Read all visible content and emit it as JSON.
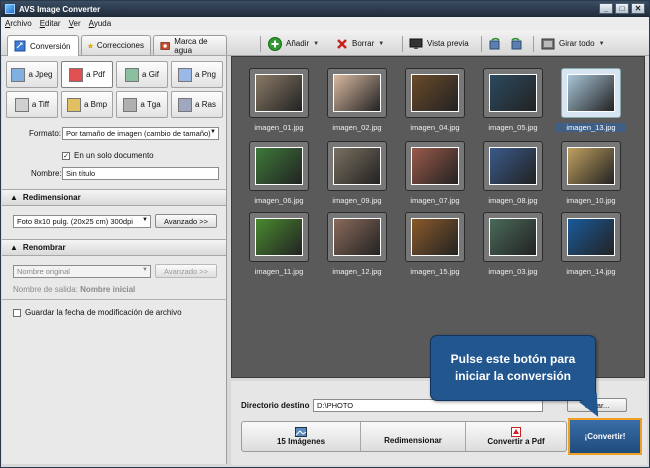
{
  "window": {
    "title": "AVS Image Converter"
  },
  "menu": [
    "Archivo",
    "Editar",
    "Ver",
    "Ayuda"
  ],
  "tabs": [
    {
      "label": "Conversión",
      "icon": "convert-icon",
      "active": true
    },
    {
      "label": "Correcciones",
      "icon": "star-icon",
      "active": false
    },
    {
      "label": "Marca de agua",
      "icon": "watermark-icon",
      "active": false
    }
  ],
  "toolbar": {
    "add": "Añadir",
    "delete": "Borrar",
    "preview": "Vista previa",
    "rotate_all": "Girar todo"
  },
  "formats": [
    "a Jpeg",
    "a Pdf",
    "a Gif",
    "a Png",
    "a Tiff",
    "a Bmp",
    "a Tga",
    "a Ras"
  ],
  "active_format": "a Pdf",
  "format_label": "Formato:",
  "format_value": "Por tamaño de imagen (cambio de tamaño)",
  "single_doc_label": "En un solo documento",
  "single_doc_checked": true,
  "name_label": "Nombre:",
  "name_value": "Sin título",
  "resize": {
    "header": "Redimensionar",
    "preset": "Foto 8x10 pulg. (20x25 cm) 300dpi",
    "advanced": "Avanzado >>"
  },
  "rename": {
    "header": "Renombrar",
    "preset": "Nombre original",
    "advanced": "Avanzado >>",
    "output_label": "Nombre de salida:",
    "output_value": "Nombre inicial"
  },
  "keep_date_label": "Guardar la fecha de modificación de archivo",
  "images": [
    {
      "name": "imagen_01.jpg",
      "color": "#8a7a66",
      "selected": false
    },
    {
      "name": "imagen_02.jpg",
      "color": "#d9b9a0",
      "selected": false
    },
    {
      "name": "imagen_04.jpg",
      "color": "#6b4b2a",
      "selected": false
    },
    {
      "name": "imagen_05.jpg",
      "color": "#2c4a60",
      "selected": false
    },
    {
      "name": "imagen_13.jpg",
      "color": "#a9c6d8",
      "selected": true
    },
    {
      "name": "imagen_06.jpg",
      "color": "#3d7a3a",
      "selected": false
    },
    {
      "name": "imagen_09.jpg",
      "color": "#7a7060",
      "selected": false
    },
    {
      "name": "imagen_07.jpg",
      "color": "#9a5a4a",
      "selected": false
    },
    {
      "name": "imagen_08.jpg",
      "color": "#3a5a8a",
      "selected": false
    },
    {
      "name": "imagen_10.jpg",
      "color": "#c0a060",
      "selected": false
    },
    {
      "name": "imagen_11.jpg",
      "color": "#4a8a30",
      "selected": false
    },
    {
      "name": "imagen_12.jpg",
      "color": "#8a6a5a",
      "selected": false
    },
    {
      "name": "imagen_15.jpg",
      "color": "#8a5a2a",
      "selected": false
    },
    {
      "name": "imagen_03.jpg",
      "color": "#4a6a5a",
      "selected": false
    },
    {
      "name": "imagen_14.jpg",
      "color": "#1a5a9a",
      "selected": false
    }
  ],
  "destination": {
    "label": "Directorio destino",
    "value": "D:\\PHOTO",
    "browse": "...inar..."
  },
  "steps": {
    "images_count": "15 Imágenes",
    "resize": "Redimensionar",
    "convert_to": "Convertir a Pdf"
  },
  "convert_button": "¡Convertir!",
  "tooltip": {
    "line1": "Pulse este botón para",
    "line2": "iniciar la conversión"
  },
  "colors": {
    "accent": "#21568f",
    "highlight": "#f0a020"
  }
}
